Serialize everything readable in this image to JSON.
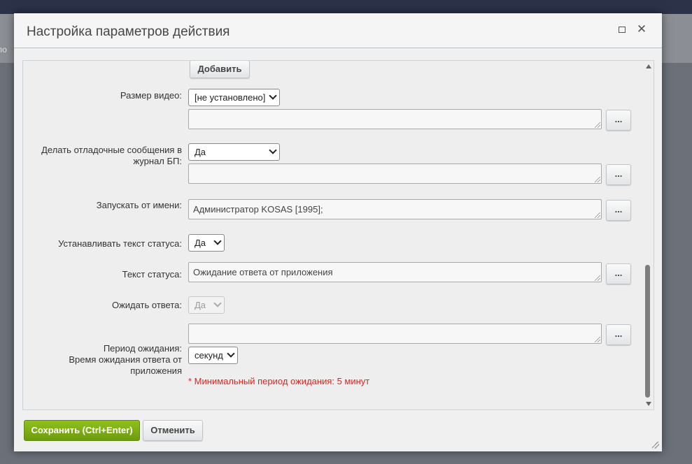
{
  "background": {
    "partial_text": "ло"
  },
  "dialog": {
    "title": "Настройка параметров действия"
  },
  "form": {
    "add_button": "Добавить",
    "video_size": {
      "label": "Размер видео:",
      "value": "[не установлено]"
    },
    "debug_messages": {
      "label_line1": "Делать отладочные сообщения в",
      "label_line2": "журнал БП:",
      "value": "Да"
    },
    "run_as": {
      "label": "Запускать от имени:",
      "value": "Администратор KOSAS [1995];"
    },
    "set_status_text": {
      "label": "Устанавливать текст статуса:",
      "value": "Да"
    },
    "status_text": {
      "label": "Текст статуса:",
      "value": "Ожидание ответа от приложения"
    },
    "wait_response": {
      "label": "Ожидать ответа:",
      "value": "Да"
    },
    "wait_period": {
      "label_line1": "Период ожидания:",
      "label_line2": "Время ожидания ответа от",
      "label_line3": "приложения",
      "unit": "секунд",
      "note": "* Минимальный период ожидания: 5 минут"
    },
    "dots_label": "..."
  },
  "footer": {
    "save_label": "Сохранить (Ctrl+Enter)",
    "cancel_label": "Отменить"
  },
  "colors": {
    "accent_green": "#7aab14",
    "error_red": "#e0241e"
  }
}
